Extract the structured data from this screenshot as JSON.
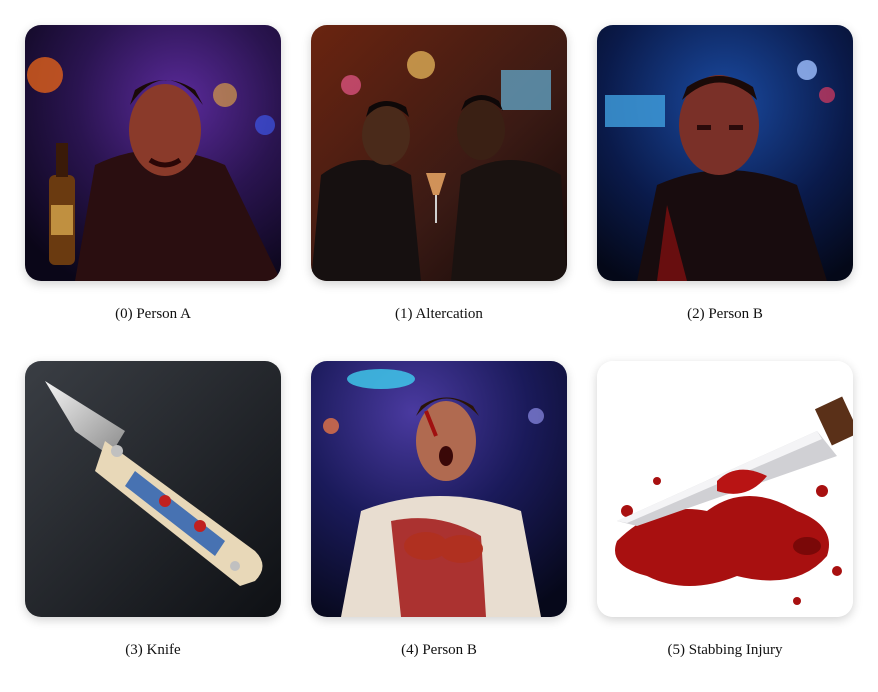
{
  "captions": [
    "(0) Person A",
    "(1) Altercation",
    "(2) Person B",
    "(3) Knife",
    "(4) Person B",
    "(5) Stabbing Injury"
  ],
  "images": [
    {
      "subject": "angry man holding bottle in nightclub",
      "palette": [
        "#1a0f3a",
        "#3a1a6a",
        "#c0401a"
      ]
    },
    {
      "subject": "two men arguing at bar",
      "palette": [
        "#2a1410",
        "#6a3018",
        "#e08a40"
      ]
    },
    {
      "subject": "stern man in nightclub",
      "palette": [
        "#0a1a3a",
        "#1a3a7a",
        "#c02020"
      ]
    },
    {
      "subject": "folding knife with ornate handle",
      "palette": [
        "#1a1c20",
        "#3a3e44",
        "#d8d8d8"
      ]
    },
    {
      "subject": "injured bloody man in club",
      "palette": [
        "#101a4a",
        "#3a2a6a",
        "#b02020"
      ]
    },
    {
      "subject": "bloody knife illustration",
      "palette": [
        "#ffffff",
        "#b01010",
        "#c8c8c8"
      ]
    }
  ]
}
